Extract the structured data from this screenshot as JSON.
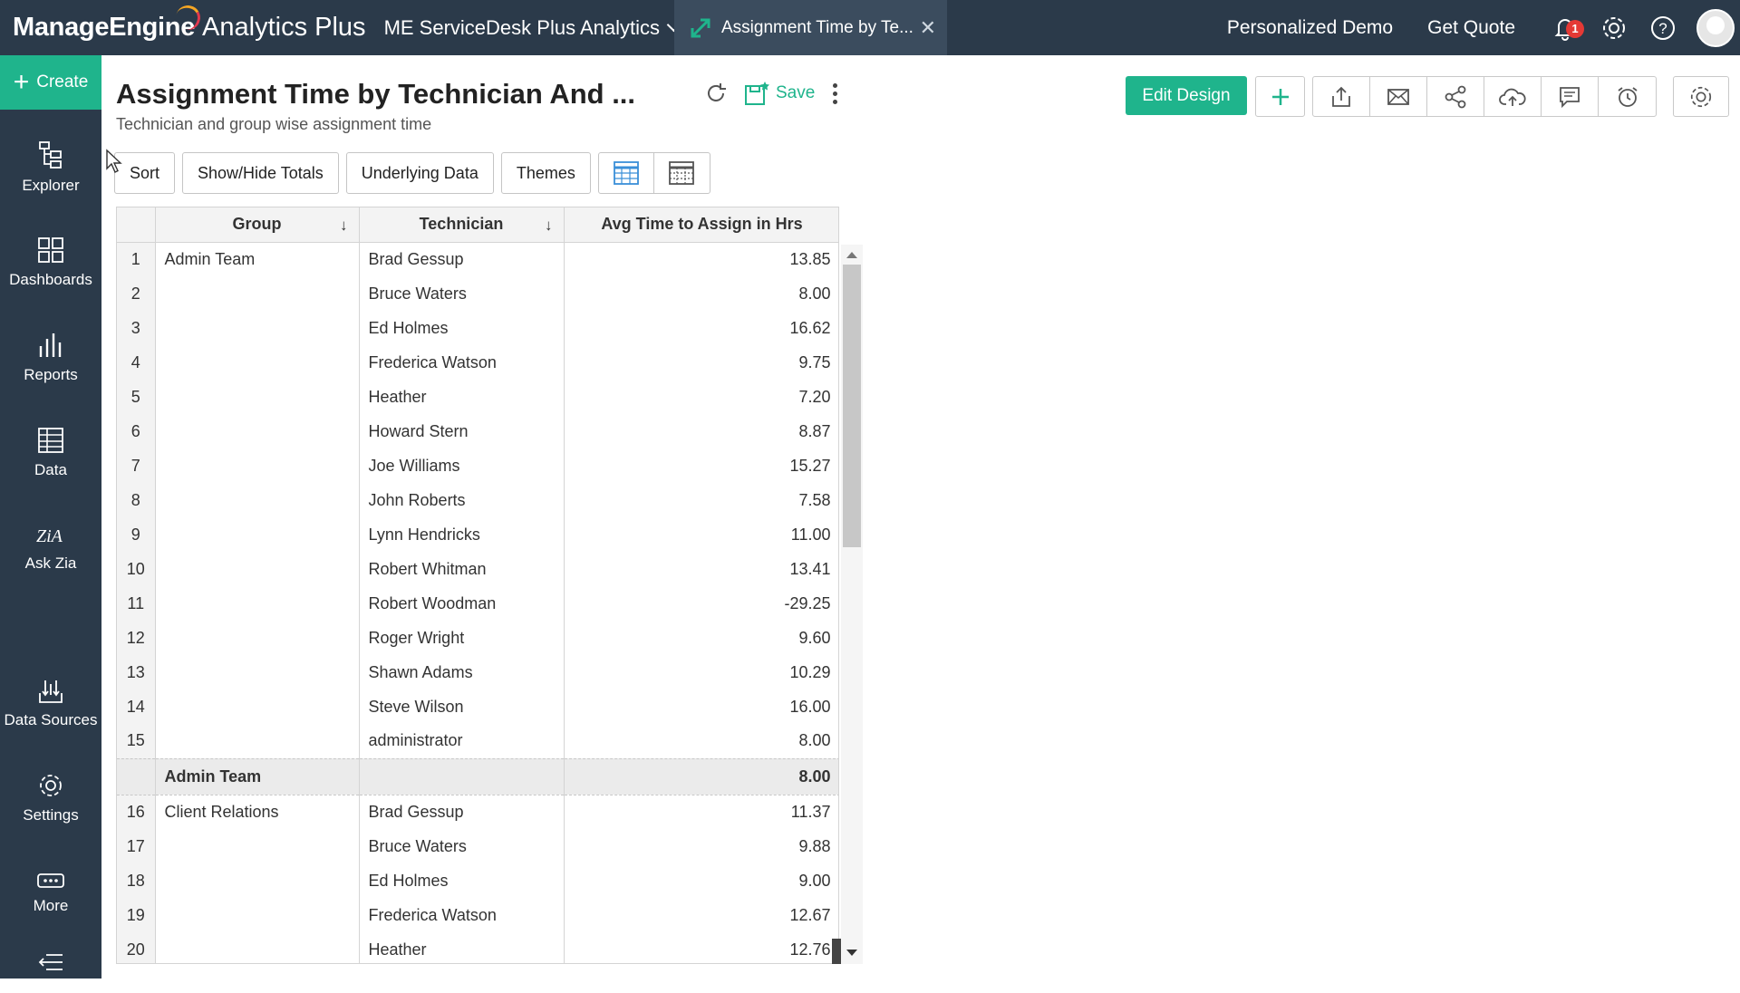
{
  "brand": {
    "name": "ManageEngine",
    "product": "Analytics Plus"
  },
  "workspace": {
    "label": "ME ServiceDesk Plus Analytics"
  },
  "tab": {
    "label": "Assignment Time by Te..."
  },
  "header_links": {
    "demo": "Personalized Demo",
    "quote": "Get Quote"
  },
  "notifications": {
    "count": "1"
  },
  "sidebar": {
    "create_label": "Create",
    "items": [
      {
        "label": "Explorer",
        "icon": "explorer-icon"
      },
      {
        "label": "Dashboards",
        "icon": "dashboards-icon"
      },
      {
        "label": "Reports",
        "icon": "reports-icon"
      },
      {
        "label": "Data",
        "icon": "data-icon"
      },
      {
        "label": "Ask Zia",
        "icon": "ask-zia-icon"
      },
      {
        "label": "Data Sources",
        "icon": "data-sources-icon"
      },
      {
        "label": "Settings",
        "icon": "settings-icon"
      },
      {
        "label": "More",
        "icon": "more-icon"
      }
    ]
  },
  "report": {
    "title": "Assignment Time by Technician And ...",
    "subtitle": "Technician and group wise assignment time",
    "save_label": "Save",
    "edit_design_label": "Edit Design"
  },
  "toolbar": {
    "sort": "Sort",
    "totals": "Show/Hide Totals",
    "underlying": "Underlying Data",
    "themes": "Themes"
  },
  "table": {
    "columns": [
      "Group",
      "Technician",
      "Avg Time to Assign in Hrs"
    ],
    "rows": [
      {
        "n": "1",
        "group": "Admin Team",
        "tech": "Brad Gessup",
        "val": "13.85"
      },
      {
        "n": "2",
        "group": "",
        "tech": "Bruce Waters",
        "val": "8.00"
      },
      {
        "n": "3",
        "group": "",
        "tech": "Ed Holmes",
        "val": "16.62"
      },
      {
        "n": "4",
        "group": "",
        "tech": "Frederica Watson",
        "val": "9.75"
      },
      {
        "n": "5",
        "group": "",
        "tech": "Heather",
        "val": "7.20"
      },
      {
        "n": "6",
        "group": "",
        "tech": "Howard Stern",
        "val": "8.87"
      },
      {
        "n": "7",
        "group": "",
        "tech": "Joe Williams",
        "val": "15.27"
      },
      {
        "n": "8",
        "group": "",
        "tech": "John Roberts",
        "val": "7.58"
      },
      {
        "n": "9",
        "group": "",
        "tech": "Lynn Hendricks",
        "val": "11.00"
      },
      {
        "n": "10",
        "group": "",
        "tech": "Robert Whitman",
        "val": "13.41"
      },
      {
        "n": "11",
        "group": "",
        "tech": "Robert Woodman",
        "val": "-29.25"
      },
      {
        "n": "12",
        "group": "",
        "tech": "Roger Wright",
        "val": "9.60"
      },
      {
        "n": "13",
        "group": "",
        "tech": "Shawn Adams",
        "val": "10.29"
      },
      {
        "n": "14",
        "group": "",
        "tech": "Steve Wilson",
        "val": "16.00"
      },
      {
        "n": "15",
        "group": "",
        "tech": "administrator",
        "val": "8.00"
      }
    ],
    "subtotal": {
      "group": "Admin Team",
      "val": "8.00"
    },
    "rows2": [
      {
        "n": "16",
        "group": "Client Relations",
        "tech": "Brad Gessup",
        "val": "11.37"
      },
      {
        "n": "17",
        "group": "",
        "tech": "Bruce Waters",
        "val": "9.88"
      },
      {
        "n": "18",
        "group": "",
        "tech": "Ed Holmes",
        "val": "9.00"
      },
      {
        "n": "19",
        "group": "",
        "tech": "Frederica Watson",
        "val": "12.67"
      },
      {
        "n": "20",
        "group": "",
        "tech": "Heather",
        "val": "12.76"
      }
    ]
  },
  "colors": {
    "topbar": "#2b3a4a",
    "accent": "#1fb48c",
    "badge": "#e53935"
  }
}
